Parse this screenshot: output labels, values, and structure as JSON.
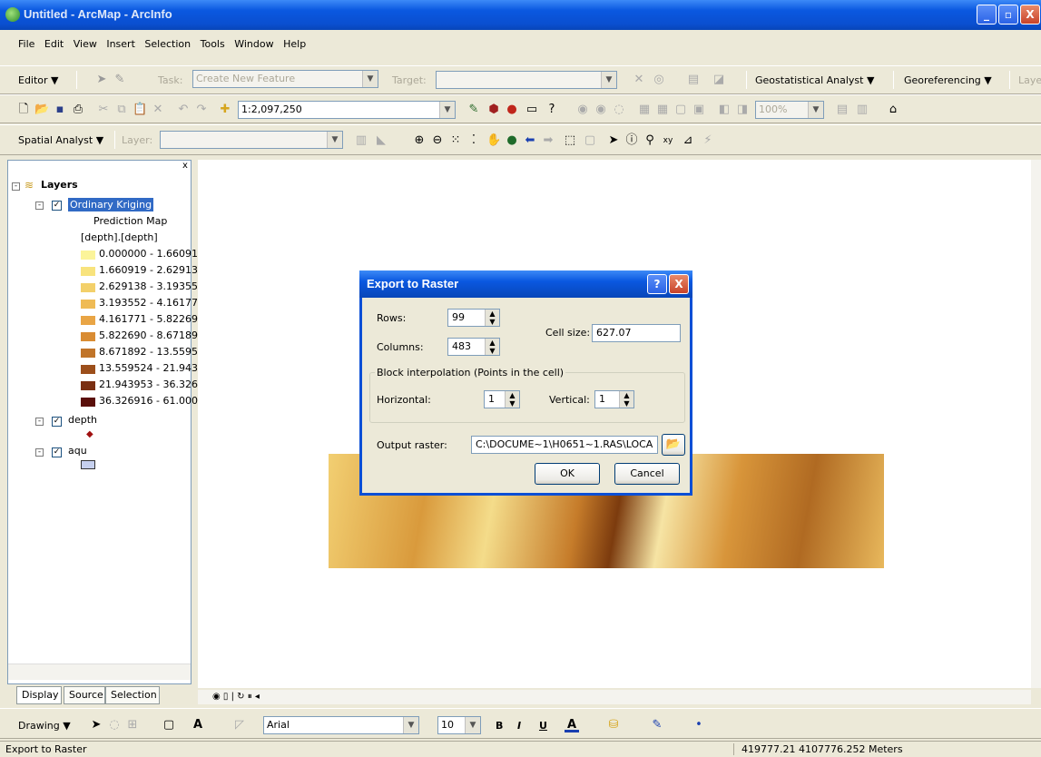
{
  "window": {
    "title": "Untitled - ArcMap - ArcInfo",
    "min": "_",
    "max": "▫",
    "close": "X"
  },
  "menu": [
    "File",
    "Edit",
    "View",
    "Insert",
    "Selection",
    "Tools",
    "Window",
    "Help"
  ],
  "editor_toolbar": {
    "editor": "Editor ▼",
    "task_label": "Task:",
    "task_value": "Create New Feature",
    "target_label": "Target:",
    "geostat": "Geostatistical Analyst ▼",
    "georef": "Georeferencing ▼",
    "layer_trunc": "Laye"
  },
  "standard_toolbar": {
    "scale": "1:2,097,250",
    "zoom_pct": "100%"
  },
  "spatial_toolbar": {
    "spatial_analyst": "Spatial Analyst ▼",
    "layer_label": "Layer:"
  },
  "toc": {
    "root": "Layers",
    "layer1": "Ordinary Kriging",
    "sub1": "Prediction Map",
    "sub2": "[depth].[depth]",
    "classes": [
      {
        "label": "0.000000 - 1.66091",
        "color": "#fbf49a"
      },
      {
        "label": "1.660919 - 2.62913",
        "color": "#f8e37d"
      },
      {
        "label": "2.629138 - 3.19355",
        "color": "#f3d06a"
      },
      {
        "label": "3.193552 - 4.16177",
        "color": "#efbb55"
      },
      {
        "label": "4.161771 - 5.82269",
        "color": "#e9a545"
      },
      {
        "label": "5.822690 - 8.67189",
        "color": "#d98c33"
      },
      {
        "label": "8.671892 - 13.5595",
        "color": "#c07429"
      },
      {
        "label": "13.559524 - 21.943",
        "color": "#9c4f1b"
      },
      {
        "label": "21.943953 - 36.326",
        "color": "#7a2f12"
      },
      {
        "label": "36.326916 - 61.000",
        "color": "#5a0f0a"
      }
    ],
    "layer2": "depth",
    "layer3": "aqu"
  },
  "tabs": [
    "Display",
    "Source",
    "Selection"
  ],
  "dialog": {
    "title": "Export to Raster",
    "rows_label": "Rows:",
    "rows": "99",
    "columns_label": "Columns:",
    "columns": "483",
    "cell_label": "Cell size:",
    "cell": "627.07",
    "group": "Block interpolation (Points in the cell)",
    "horizontal_label": "Horizontal:",
    "horizontal": "1",
    "vertical_label": "Vertical:",
    "vertical": "1",
    "output_label": "Output raster:",
    "output": "C:\\DOCUME~1\\H0651~1.RAS\\LOCA",
    "ok": "OK",
    "cancel": "Cancel",
    "help": "?",
    "close": "X"
  },
  "drawing_toolbar": {
    "drawing": "Drawing ▼",
    "font": "Arial",
    "size": "10",
    "bold": "B",
    "italic": "I",
    "underline": "U"
  },
  "status": {
    "left": "Export to Raster",
    "coords": "419777.21  4107776.252 Meters"
  }
}
